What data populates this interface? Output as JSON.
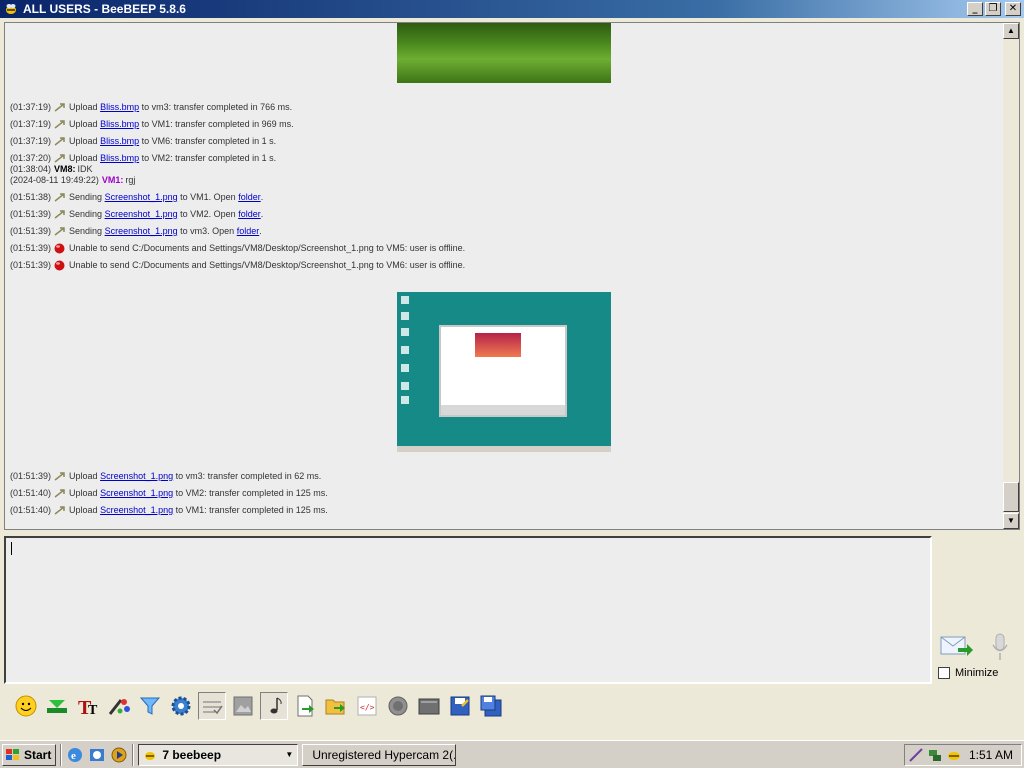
{
  "window": {
    "title": "ALL USERS - BeeBEEP 5.8.6"
  },
  "chat": {
    "lines": [
      {
        "ts": "(01:37:19)",
        "pre": "Upload",
        "link": "Bliss.bmp",
        "post": "to vm3: transfer completed in 766 ms."
      },
      {
        "ts": "(01:37:19)",
        "pre": "Upload",
        "link": "Bliss.bmp",
        "post": "to VM1: transfer completed in 969 ms."
      },
      {
        "ts": "(01:37:19)",
        "pre": "Upload",
        "link": "Bliss.bmp",
        "post": "to VM6: transfer completed in 1 s."
      },
      {
        "ts": "(01:37:20)",
        "pre": "Upload",
        "link": "Bliss.bmp",
        "post": "to VM2: transfer completed in 1 s."
      },
      {
        "ts": "(01:38:04)",
        "nick": "VM8:",
        "msg": "IDK"
      },
      {
        "ts": "(2024-08-11 19:49:22)",
        "nick": "VM1:",
        "msg": "rgj"
      },
      {
        "ts": "(01:51:38)",
        "pre": "Sending",
        "link": "Screenshot_1.png",
        "post": "to VM1. Open",
        "link2": "folder",
        "end": "."
      },
      {
        "ts": "(01:51:39)",
        "pre": "Sending",
        "link": "Screenshot_1.png",
        "post": "to VM2. Open",
        "link2": "folder",
        "end": "."
      },
      {
        "ts": "(01:51:39)",
        "pre": "Sending",
        "link": "Screenshot_1.png",
        "post": "to vm3. Open",
        "link2": "folder",
        "end": "."
      },
      {
        "ts": "(01:51:39)",
        "text": "Unable to send C:/Documents and Settings/VM8/Desktop/Screenshot_1.png to VM5: user is offline."
      },
      {
        "ts": "(01:51:39)",
        "text": "Unable to send C:/Documents and Settings/VM8/Desktop/Screenshot_1.png to VM6: user is offline."
      },
      {
        "ts": "(01:51:39)",
        "pre": "Upload",
        "link": "Screenshot_1.png",
        "post": "to vm3: transfer completed in 62 ms."
      },
      {
        "ts": "(01:51:40)",
        "pre": "Upload",
        "link": "Screenshot_1.png",
        "post": "to VM2: transfer completed in 125 ms."
      },
      {
        "ts": "(01:51:40)",
        "pre": "Upload",
        "link": "Screenshot_1.png",
        "post": "to VM1: transfer completed in 125 ms."
      }
    ]
  },
  "composer": {
    "minimize_label": "Minimize",
    "minimize_checked": false
  },
  "toolbar": {
    "icons": [
      "emoticon-icon",
      "green-arrow-icon",
      "font-icon",
      "color-icon",
      "filter-icon",
      "settings-icon",
      "spellcheck-icon",
      "image-icon",
      "music-note-icon",
      "send-file-icon",
      "send-folder-icon",
      "code-icon",
      "record-icon",
      "screenshot-icon",
      "save-icon",
      "save-as-icon"
    ]
  },
  "taskbar": {
    "start_label": "Start",
    "tasks": [
      {
        "label": "7 beebeep",
        "active": true
      },
      {
        "label": "Unregistered Hypercam 2(...",
        "active": false
      }
    ],
    "clock": "1:51 AM"
  },
  "colors": {
    "link": "#0000cc",
    "nick_vm1": "#a000c8",
    "desktop_teal": "#168a86",
    "title_gradient_start": "#0a246a"
  }
}
